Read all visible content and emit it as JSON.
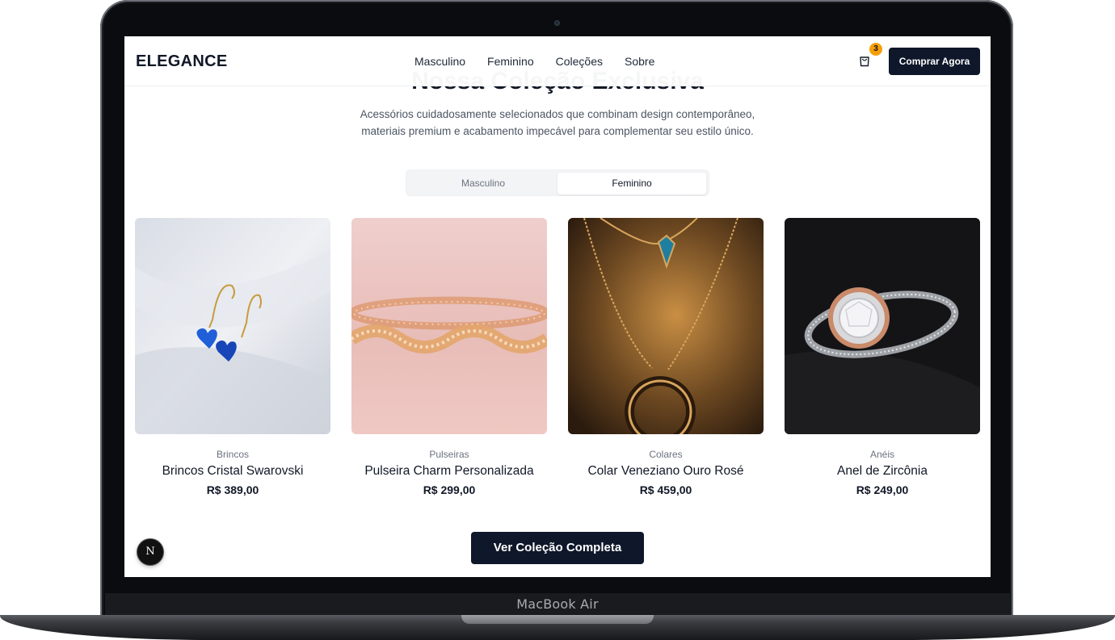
{
  "device": {
    "label": "MacBook Air"
  },
  "navbar": {
    "brand": "ELEGANCE",
    "links": [
      "Masculino",
      "Feminino",
      "Coleções",
      "Sobre"
    ],
    "cart_count": "3",
    "cta_label": "Comprar Agora",
    "cart_icon": "shopping-bag-icon"
  },
  "section": {
    "title": "Nossa Coleção Exclusiva",
    "description": "Acessórios cuidadosamente selecionados que combinam design contemporâneo, materiais premium e acabamento impecável para complementar seu estilo único."
  },
  "tabs": {
    "items": [
      "Masculino",
      "Feminino"
    ],
    "active": "Feminino"
  },
  "products": [
    {
      "category": "Brincos",
      "name": "Brincos Cristal Swarovski",
      "price": "R$ 389,00"
    },
    {
      "category": "Pulseiras",
      "name": "Pulseira Charm Personalizada",
      "price": "R$ 299,00"
    },
    {
      "category": "Colares",
      "name": "Colar Veneziano Ouro Rosé",
      "price": "R$ 459,00"
    },
    {
      "category": "Anéis",
      "name": "Anel de Zircônia",
      "price": "R$ 249,00"
    }
  ],
  "footer_cta": {
    "label": "Ver Coleção Completa"
  },
  "dev_badge": {
    "letter": "N"
  }
}
